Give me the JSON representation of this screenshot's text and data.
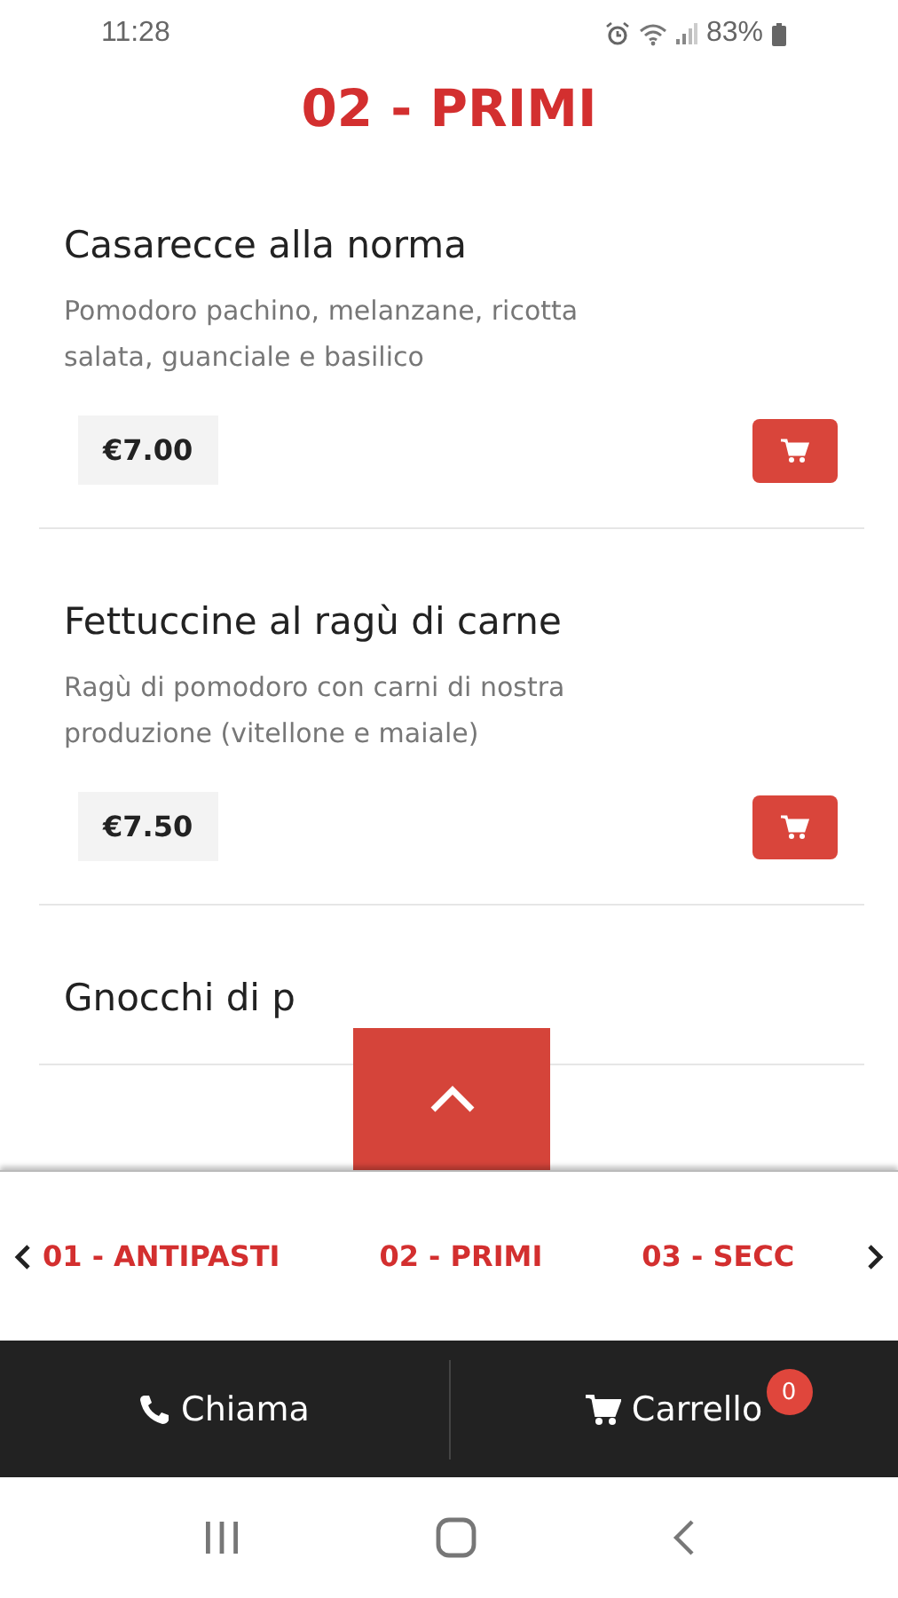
{
  "status_bar": {
    "time": "11:28",
    "battery": "83%"
  },
  "title": "02 - PRIMI",
  "dishes": [
    {
      "name": "Casarecce alla norma",
      "description": "Pomodoro pachino, melanzane, ricotta salata, guanciale e basilico",
      "price": "€7.00"
    },
    {
      "name": "Fettuccine al ragù di carne",
      "description": "Ragù di pomodoro con carni di nostra produzione (vitellone e maiale)",
      "price": "€7.50"
    },
    {
      "name": "Gnocchi di p"
    }
  ],
  "categories": [
    "01 - ANTIPASTI",
    "02 - PRIMI",
    "03 - SECC"
  ],
  "bottom_bar": {
    "call": "Chiama",
    "cart": "Carrello",
    "cart_count": "0"
  }
}
